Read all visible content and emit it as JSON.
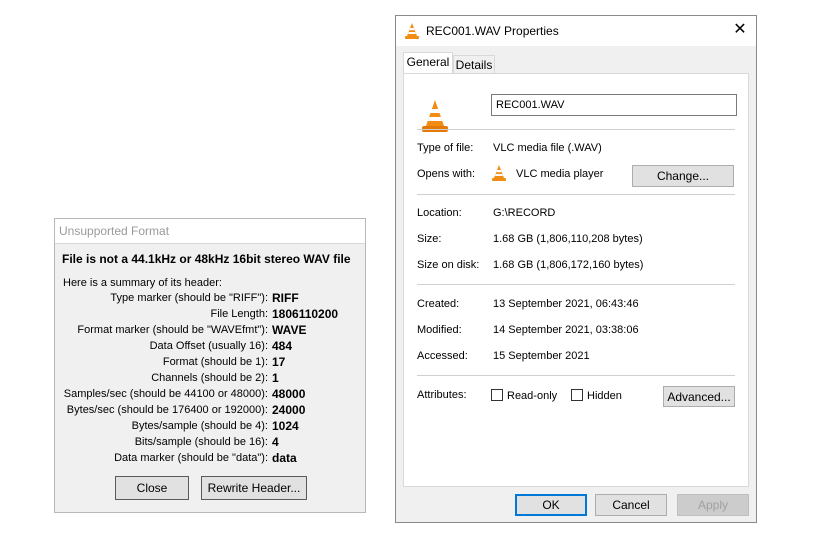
{
  "unsupported_dialog": {
    "title": "Unsupported Format",
    "heading": "File is not a 44.1kHz or 48kHz 16bit stereo WAV file",
    "summary_label": "Here is a summary of its header:",
    "rows": [
      {
        "label": "Type marker (should be \"RIFF\"):",
        "value": "RIFF"
      },
      {
        "label": "File Length:",
        "value": "1806110200"
      },
      {
        "label": "Format marker (should be \"WAVEfmt\"):",
        "value": "WAVE"
      },
      {
        "label": "Data Offset (usually 16):",
        "value": "484"
      },
      {
        "label": "Format (should be 1):",
        "value": "17"
      },
      {
        "label": "Channels (should be 2):",
        "value": "1"
      },
      {
        "label": "Samples/sec (should be 44100 or 48000):",
        "value": "48000"
      },
      {
        "label": "Bytes/sec (should be 176400 or 192000):",
        "value": "24000"
      },
      {
        "label": "Bytes/sample (should be 4):",
        "value": "1024"
      },
      {
        "label": "Bits/sample (should be 16):",
        "value": "4"
      },
      {
        "label": "Data marker (should be \"data\"):",
        "value": "data"
      }
    ],
    "close_label": "Close",
    "rewrite_label": "Rewrite Header..."
  },
  "properties_dialog": {
    "title": "REC001.WAV Properties",
    "close_glyph": "✕",
    "tabs": [
      {
        "label": "General",
        "active": true
      },
      {
        "label": "Details",
        "active": false
      }
    ],
    "file_name": "REC001.WAV",
    "type_label": "Type of file:",
    "type_value": "VLC media file (.WAV)",
    "opens_label": "Opens with:",
    "opens_value": "VLC media player",
    "change_label": "Change...",
    "location_label": "Location:",
    "location_value": "G:\\RECORD",
    "size_label": "Size:",
    "size_value": "1.68 GB (1,806,110,208 bytes)",
    "size_disk_label": "Size on disk:",
    "size_disk_value": "1.68 GB (1,806,172,160 bytes)",
    "created_label": "Created:",
    "created_value": "13 September 2021, 06:43:46",
    "modified_label": "Modified:",
    "modified_value": "14 September 2021, 03:38:06",
    "accessed_label": "Accessed:",
    "accessed_value": "15 September 2021",
    "attributes_label": "Attributes:",
    "readonly_label": "Read-only",
    "hidden_label": "Hidden",
    "advanced_label": "Advanced...",
    "ok_label": "OK",
    "cancel_label": "Cancel",
    "apply_label": "Apply",
    "icon": "vlc-cone-icon",
    "colors": {
      "cone_orange": "#f28c12",
      "focus_blue": "#0078d7"
    }
  }
}
